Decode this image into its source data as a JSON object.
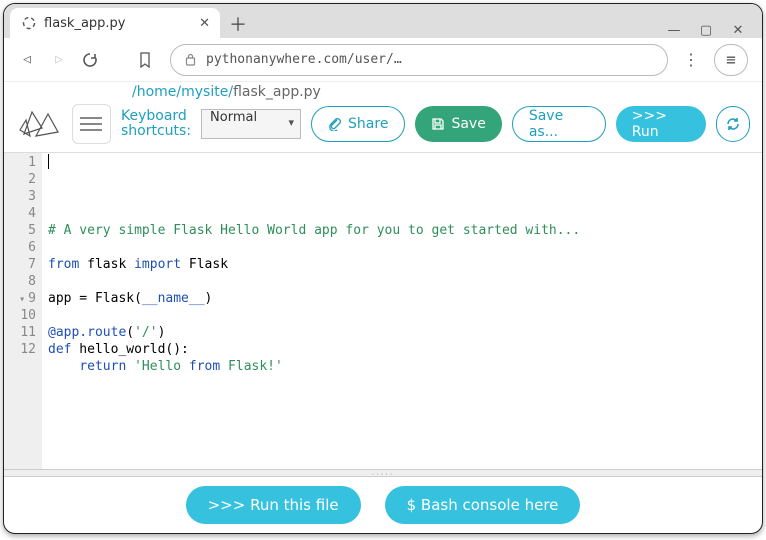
{
  "browser": {
    "tab_title": "flask_app.py",
    "url_display": "pythonanywhere.com/user/…"
  },
  "breadcrumbs": {
    "seg1": "/home/",
    "seg2": "mysite/",
    "current": "flask_app.py"
  },
  "toolbar": {
    "keyboard_label_line1": "Keyboard",
    "keyboard_label_line2": "shortcuts:",
    "mode_selected": "Normal",
    "share_label": "Share",
    "save_label": "Save",
    "saveas_label": "Save as...",
    "run_label": ">>> Run"
  },
  "editor": {
    "line_count": 12,
    "fold_line": 9,
    "lines": [
      "",
      "# A very simple Flask Hello World app for you to get started with...",
      "",
      "from flask import Flask",
      "",
      "app = Flask(__name__)",
      "",
      "@app.route('/')",
      "def hello_world():",
      "    return 'Hello from Flask!'",
      "",
      ""
    ]
  },
  "bottom": {
    "run_file_label": ">>> Run this file",
    "bash_label": "$ Bash console here"
  }
}
